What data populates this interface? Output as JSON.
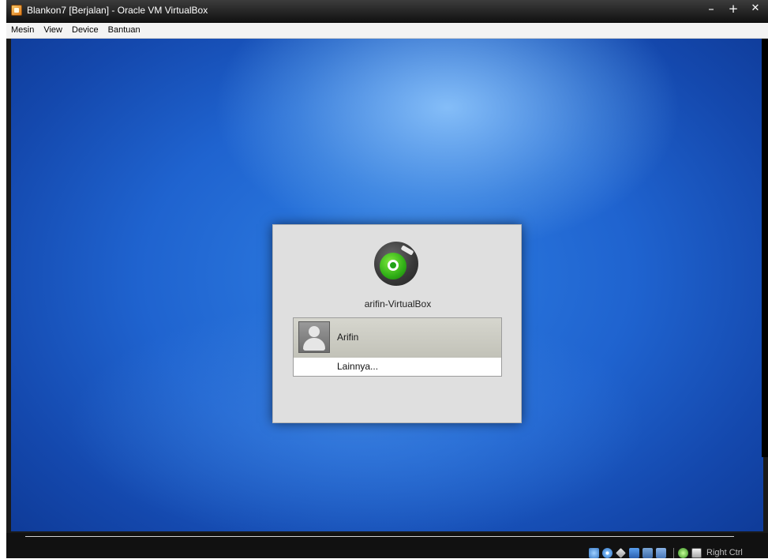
{
  "window": {
    "title": "Blankon7 [Berjalan] - Oracle VM VirtualBox",
    "controls": {
      "minimize": "–",
      "maximize": "+",
      "close": "✕"
    }
  },
  "menubar": {
    "items": [
      "Mesin",
      "View",
      "Device",
      "Bantuan"
    ]
  },
  "login": {
    "hostname": "arifin-VirtualBox",
    "user_name": "Arifin",
    "other_label": "Lainnya..."
  },
  "statusbar": {
    "host_key": "Right Ctrl",
    "icons": [
      "hard-disk-icon",
      "cd-dvd-icon",
      "usb-icon",
      "network-icon",
      "shared-folders-icon",
      "display-icon",
      "mouse-integration-icon",
      "host-key-icon"
    ]
  },
  "colors": {
    "desktop_blue": "#1f63cf",
    "titlebar": "#101010",
    "dialog_bg": "#dfdfdf"
  }
}
